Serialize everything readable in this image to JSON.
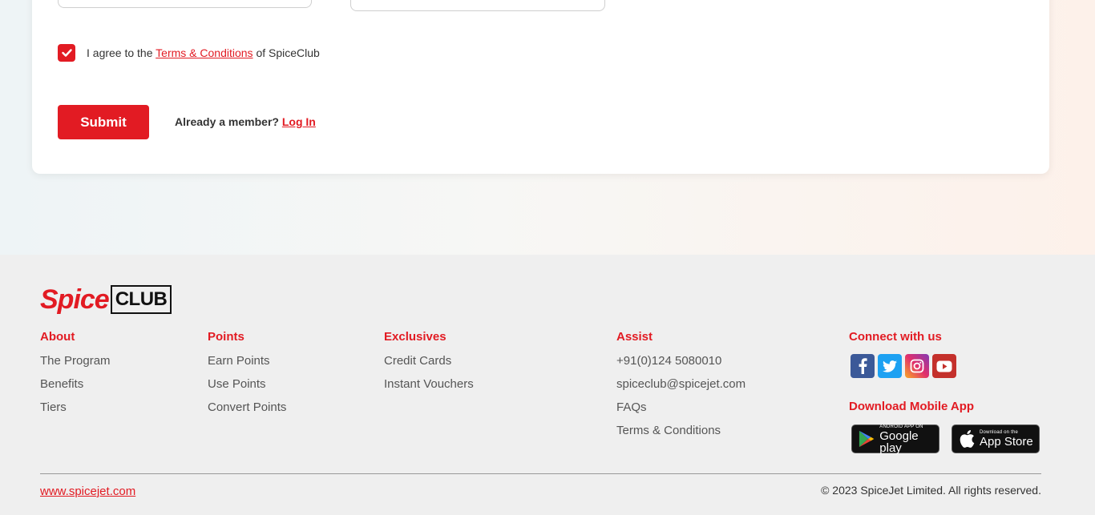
{
  "form": {
    "agree_prefix": "I agree to the",
    "terms_link": "Terms & Conditions",
    "agree_suffix": "of SpiceClub",
    "submit_label": "Submit",
    "member_prompt": "Already a member?",
    "login_link": "Log In"
  },
  "footer": {
    "logo": {
      "spice": "Spice",
      "club": "CLUB"
    },
    "about": {
      "heading": "About",
      "items": [
        "The Program",
        "Benefits",
        "Tiers"
      ]
    },
    "points": {
      "heading": "Points",
      "items": [
        "Earn Points",
        "Use Points",
        "Convert Points"
      ]
    },
    "exclusives": {
      "heading": "Exclusives",
      "items": [
        "Credit Cards",
        "Instant Vouchers"
      ]
    },
    "assist": {
      "heading": "Assist",
      "items": [
        "+91(0)124 5080010",
        "spiceclub@spicejet.com",
        "FAQs",
        "Terms & Conditions"
      ]
    },
    "connect": {
      "heading": "Connect with us",
      "icons": [
        "facebook-icon",
        "twitter-icon",
        "instagram-icon",
        "youtube-icon"
      ]
    },
    "app": {
      "heading": "Download Mobile App",
      "google_small": "ANDROID APP ON",
      "google_big": "Google play",
      "apple_small": "Download on the",
      "apple_big": "App Store"
    },
    "site_link": "www.spicejet.com",
    "copyright": "© 2023 SpiceJet Limited. All rights reserved."
  },
  "colors": {
    "accent": "#e21b23",
    "footer_bg": "#efefef"
  }
}
